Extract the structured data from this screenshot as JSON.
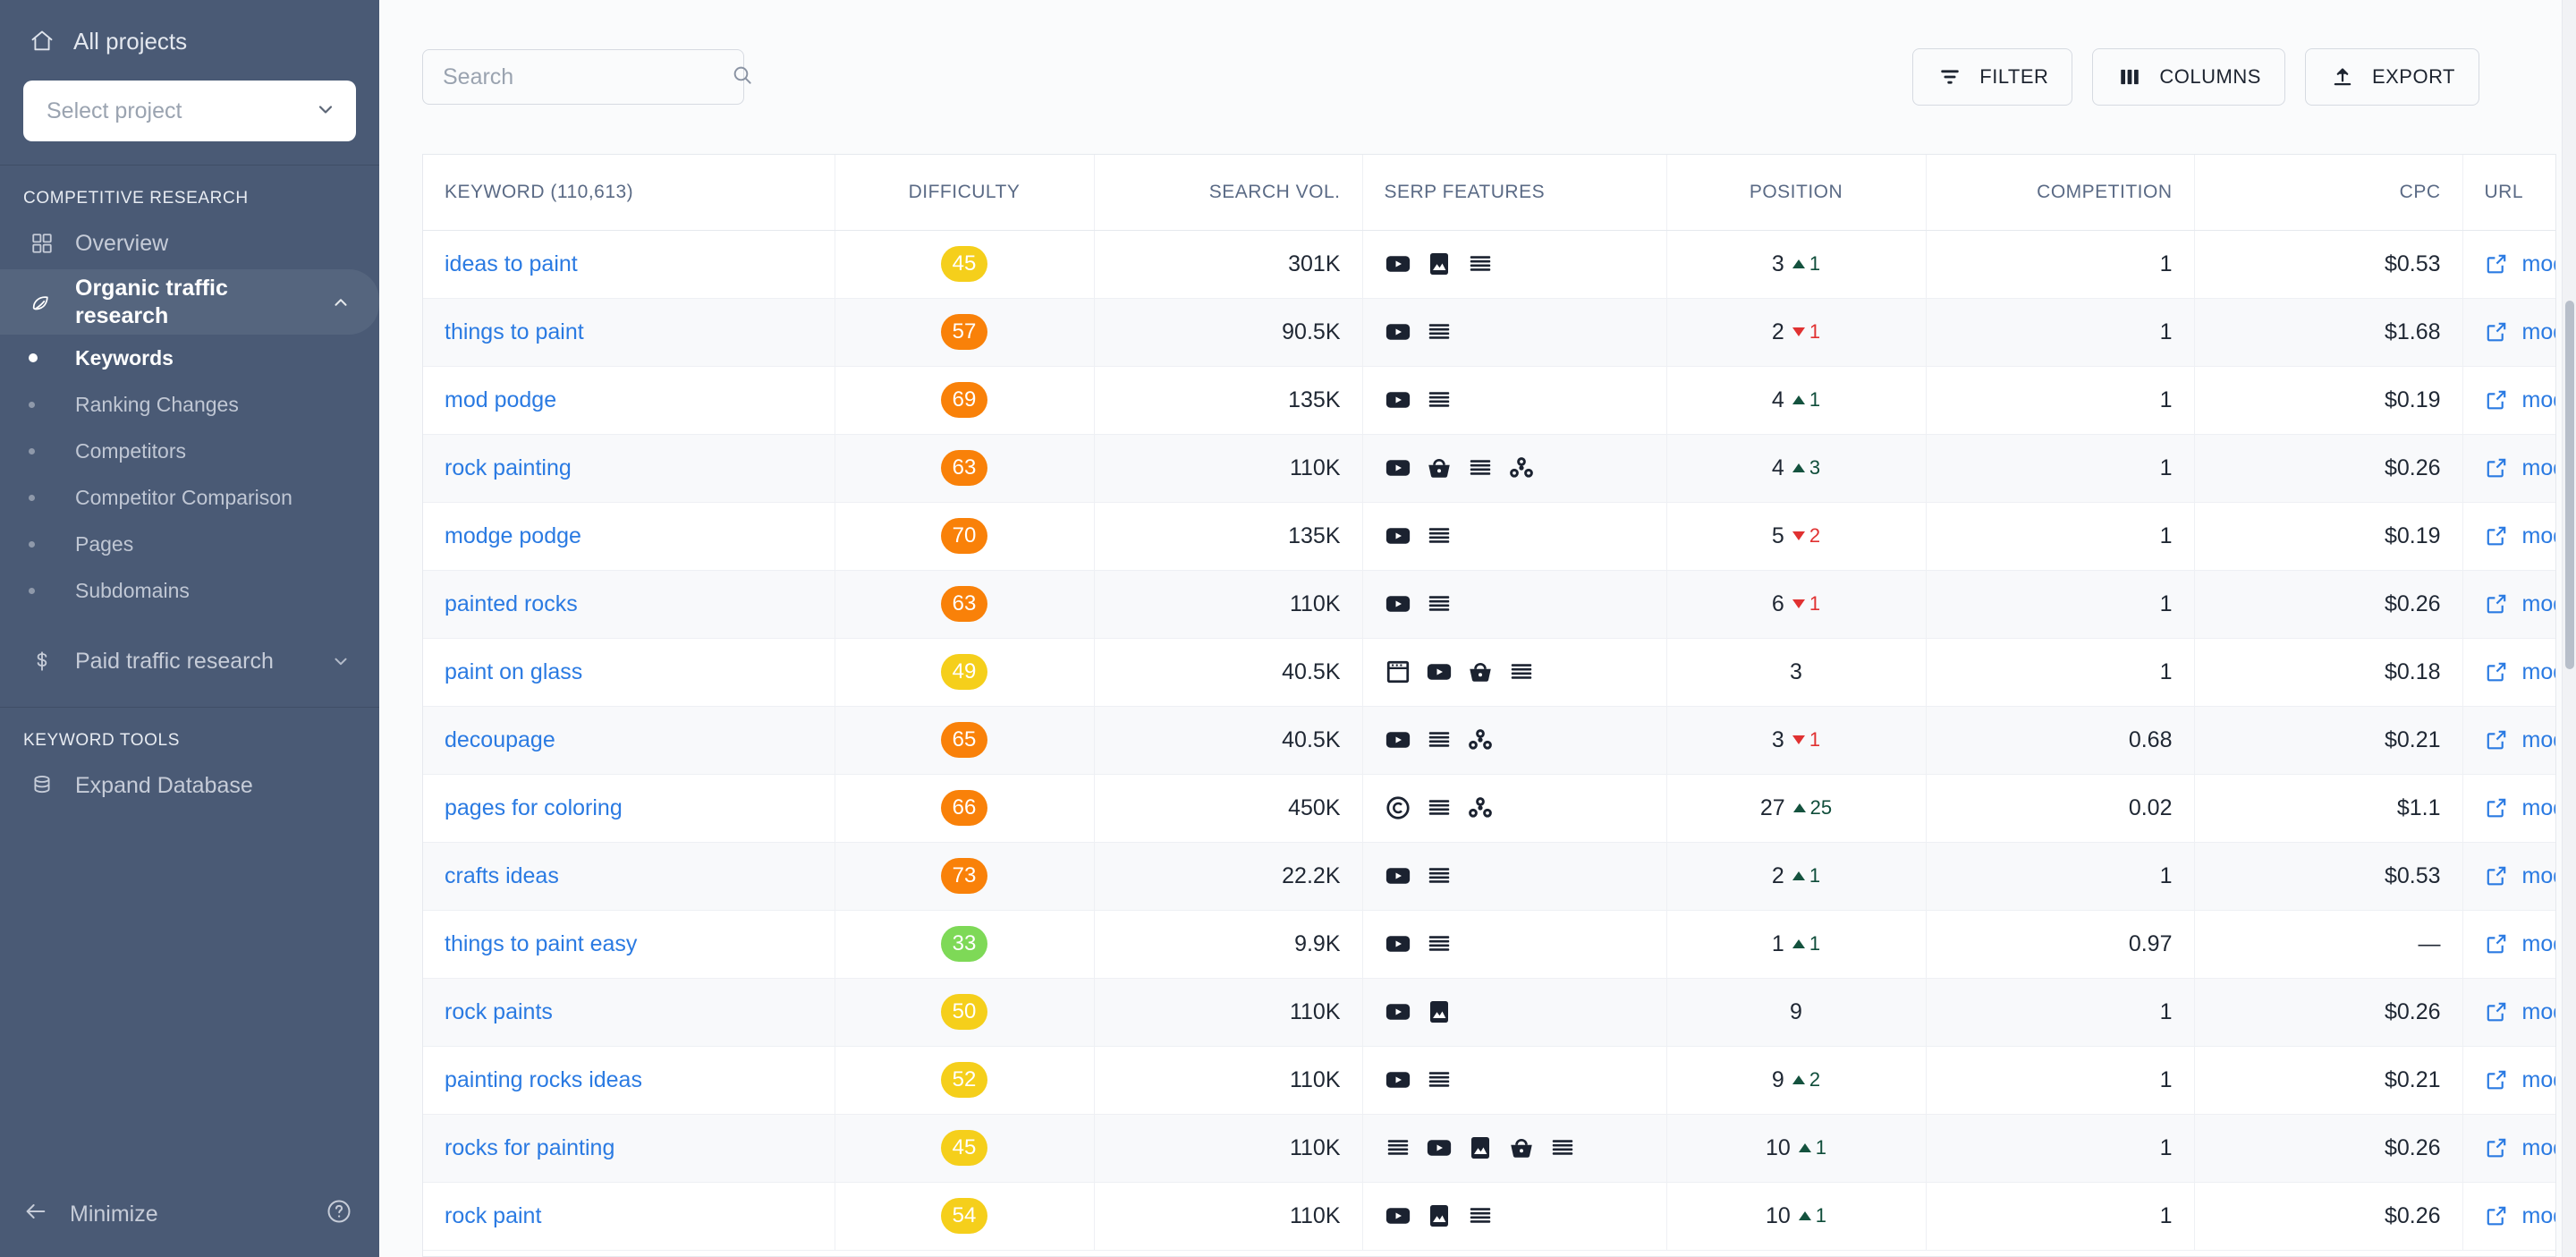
{
  "sidebar": {
    "all_projects": "All projects",
    "project_select": "Select project",
    "sections": [
      {
        "title": "COMPETITIVE RESEARCH",
        "items": [
          {
            "label": "Overview",
            "icon": "grid-icon",
            "active": false
          },
          {
            "label": "Organic traffic research",
            "icon": "leaf-icon",
            "active": true,
            "chevron": "chevron-up-icon"
          }
        ],
        "subitems": [
          {
            "label": "Keywords",
            "current": true
          },
          {
            "label": "Ranking Changes",
            "current": false
          },
          {
            "label": "Competitors",
            "current": false
          },
          {
            "label": "Competitor Comparison",
            "current": false
          },
          {
            "label": "Pages",
            "current": false
          },
          {
            "label": "Subdomains",
            "current": false
          }
        ],
        "trailing": [
          {
            "label": "Paid traffic research",
            "icon": "dollar-icon",
            "chevron": "chevron-down-icon"
          }
        ]
      },
      {
        "title": "KEYWORD TOOLS",
        "items": [
          {
            "label": "Expand Database",
            "icon": "database-icon",
            "active": false
          }
        ],
        "subitems": [],
        "trailing": []
      }
    ],
    "minimize": "Minimize",
    "help_icon": "question-circle-icon"
  },
  "toolbar": {
    "search_placeholder": "Search",
    "search_value": "",
    "search_icon": "search-icon",
    "buttons": [
      {
        "label": "FILTER",
        "icon": "filter-icon"
      },
      {
        "label": "COLUMNS",
        "icon": "columns-icon"
      },
      {
        "label": "EXPORT",
        "icon": "upload-icon"
      }
    ]
  },
  "table": {
    "columns": [
      {
        "key": "keyword",
        "label": "KEYWORD  (110,613)"
      },
      {
        "key": "difficulty",
        "label": "DIFFICULTY"
      },
      {
        "key": "volume",
        "label": "SEARCH VOL."
      },
      {
        "key": "serp",
        "label": "SERP FEATURES"
      },
      {
        "key": "position",
        "label": "POSITION"
      },
      {
        "key": "competition",
        "label": "COMPETITION"
      },
      {
        "key": "cpc",
        "label": "CPC"
      },
      {
        "key": "url",
        "label": "URL"
      }
    ],
    "keyword_count": "110,613",
    "url_text": "modpodgerocksbl",
    "difficulty_colors": {
      "green": "#7ed957",
      "yellow": "#f5cf1b",
      "orange": "#f98109"
    },
    "rows": [
      {
        "keyword": "ideas to paint",
        "difficulty": 45,
        "diff_color": "yellow",
        "volume": "301K",
        "serp": [
          "video",
          "image",
          "snippet"
        ],
        "position": "3",
        "delta": 1,
        "delta_dir": "up",
        "competition": "1",
        "cpc": "$0.53"
      },
      {
        "keyword": "things to paint",
        "difficulty": 57,
        "diff_color": "orange",
        "volume": "90.5K",
        "serp": [
          "video",
          "snippet"
        ],
        "position": "2",
        "delta": 1,
        "delta_dir": "down",
        "competition": "1",
        "cpc": "$1.68"
      },
      {
        "keyword": "mod podge",
        "difficulty": 69,
        "diff_color": "orange",
        "volume": "135K",
        "serp": [
          "video",
          "snippet"
        ],
        "position": "4",
        "delta": 1,
        "delta_dir": "up",
        "competition": "1",
        "cpc": "$0.19"
      },
      {
        "keyword": "rock painting",
        "difficulty": 63,
        "diff_color": "orange",
        "volume": "110K",
        "serp": [
          "video",
          "shopping",
          "snippet",
          "related"
        ],
        "position": "4",
        "delta": 3,
        "delta_dir": "up",
        "competition": "1",
        "cpc": "$0.26"
      },
      {
        "keyword": "modge podge",
        "difficulty": 70,
        "diff_color": "orange",
        "volume": "135K",
        "serp": [
          "video",
          "snippet"
        ],
        "position": "5",
        "delta": 2,
        "delta_dir": "down",
        "competition": "1",
        "cpc": "$0.19"
      },
      {
        "keyword": "painted rocks",
        "difficulty": 63,
        "diff_color": "orange",
        "volume": "110K",
        "serp": [
          "video",
          "snippet"
        ],
        "position": "6",
        "delta": 1,
        "delta_dir": "down",
        "competition": "1",
        "cpc": "$0.26"
      },
      {
        "keyword": "paint on glass",
        "difficulty": 49,
        "diff_color": "yellow",
        "volume": "40.5K",
        "serp": [
          "reviews",
          "video",
          "shopping",
          "snippet"
        ],
        "position": "3",
        "delta": null,
        "delta_dir": null,
        "competition": "1",
        "cpc": "$0.18"
      },
      {
        "keyword": "decoupage",
        "difficulty": 65,
        "diff_color": "orange",
        "volume": "40.5K",
        "serp": [
          "video",
          "snippet",
          "related"
        ],
        "position": "3",
        "delta": 1,
        "delta_dir": "down",
        "competition": "0.68",
        "cpc": "$0.21"
      },
      {
        "keyword": "pages for coloring",
        "difficulty": 66,
        "diff_color": "orange",
        "volume": "450K",
        "serp": [
          "copyright",
          "snippet",
          "related"
        ],
        "position": "27",
        "delta": 25,
        "delta_dir": "up",
        "competition": "0.02",
        "cpc": "$1.1"
      },
      {
        "keyword": "crafts ideas",
        "difficulty": 73,
        "diff_color": "orange",
        "volume": "22.2K",
        "serp": [
          "video",
          "snippet"
        ],
        "position": "2",
        "delta": 1,
        "delta_dir": "up",
        "competition": "1",
        "cpc": "$0.53"
      },
      {
        "keyword": "things to paint easy",
        "difficulty": 33,
        "diff_color": "green",
        "volume": "9.9K",
        "serp": [
          "video",
          "snippet"
        ],
        "position": "1",
        "delta": 1,
        "delta_dir": "up",
        "competition": "0.97",
        "cpc": "—"
      },
      {
        "keyword": "rock paints",
        "difficulty": 50,
        "diff_color": "yellow",
        "volume": "110K",
        "serp": [
          "video",
          "image"
        ],
        "position": "9",
        "delta": null,
        "delta_dir": null,
        "competition": "1",
        "cpc": "$0.26"
      },
      {
        "keyword": "painting rocks ideas",
        "difficulty": 52,
        "diff_color": "yellow",
        "volume": "110K",
        "serp": [
          "video",
          "snippet"
        ],
        "position": "9",
        "delta": 2,
        "delta_dir": "up",
        "competition": "1",
        "cpc": "$0.21"
      },
      {
        "keyword": "rocks for painting",
        "difficulty": 45,
        "diff_color": "yellow",
        "volume": "110K",
        "serp": [
          "snippet",
          "video",
          "image",
          "shopping",
          "snippet"
        ],
        "position": "10",
        "delta": 1,
        "delta_dir": "up",
        "competition": "1",
        "cpc": "$0.26"
      },
      {
        "keyword": "rock paint",
        "difficulty": 54,
        "diff_color": "yellow",
        "volume": "110K",
        "serp": [
          "video",
          "image",
          "snippet"
        ],
        "position": "10",
        "delta": 1,
        "delta_dir": "up",
        "competition": "1",
        "cpc": "$0.26"
      }
    ]
  }
}
